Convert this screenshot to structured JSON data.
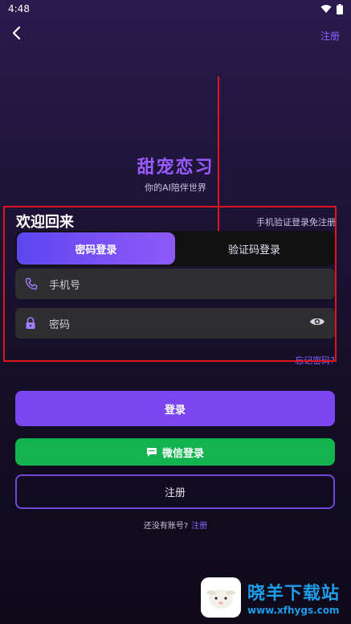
{
  "status": {
    "time": "4:48"
  },
  "header": {
    "register_link": "注册"
  },
  "brand": {
    "title": "甜宠恋习",
    "subtitle": "你的AI陪伴世界"
  },
  "login": {
    "welcome": "欢迎回来",
    "sms_hint": "手机验证登录免注册",
    "tabs": [
      {
        "label": "密码登录",
        "active": true
      },
      {
        "label": "验证码登录",
        "active": false
      }
    ],
    "phone_placeholder": "手机号",
    "password_placeholder": "密码",
    "forgot": "忘记密码?"
  },
  "buttons": {
    "login": "登录",
    "wechat": "微信登录",
    "register": "注册"
  },
  "footer": {
    "no_account": "还没有账号?",
    "register_link": "注册"
  },
  "watermark": {
    "name": "晓羊下载站",
    "url": "www.xfhygs.com"
  },
  "colors": {
    "accent": "#8a63ff",
    "login_button": "#7b45f0",
    "wechat_button": "#13b44f",
    "annotation": "#e0141c"
  }
}
